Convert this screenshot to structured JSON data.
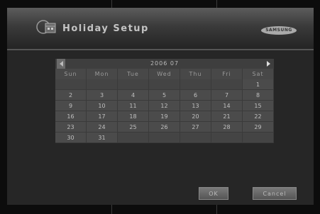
{
  "header": {
    "title": "Holiday Setup",
    "brand": "SAMSUNG"
  },
  "calendar": {
    "month_label": "2006   07",
    "weekdays": [
      "Sun",
      "Mon",
      "Tue",
      "Wed",
      "Thu",
      "Fri",
      "Sat"
    ],
    "weeks": [
      [
        "",
        "",
        "",
        "",
        "",
        "",
        "1"
      ],
      [
        "2",
        "3",
        "4",
        "5",
        "6",
        "7",
        "8"
      ],
      [
        "9",
        "10",
        "11",
        "12",
        "13",
        "14",
        "15"
      ],
      [
        "16",
        "17",
        "18",
        "19",
        "20",
        "21",
        "22"
      ],
      [
        "23",
        "24",
        "25",
        "26",
        "27",
        "28",
        "29"
      ],
      [
        "30",
        "31",
        "",
        "",
        "",
        "",
        ""
      ]
    ]
  },
  "buttons": {
    "ok_label": "OK",
    "cancel_label": "Cancel"
  }
}
